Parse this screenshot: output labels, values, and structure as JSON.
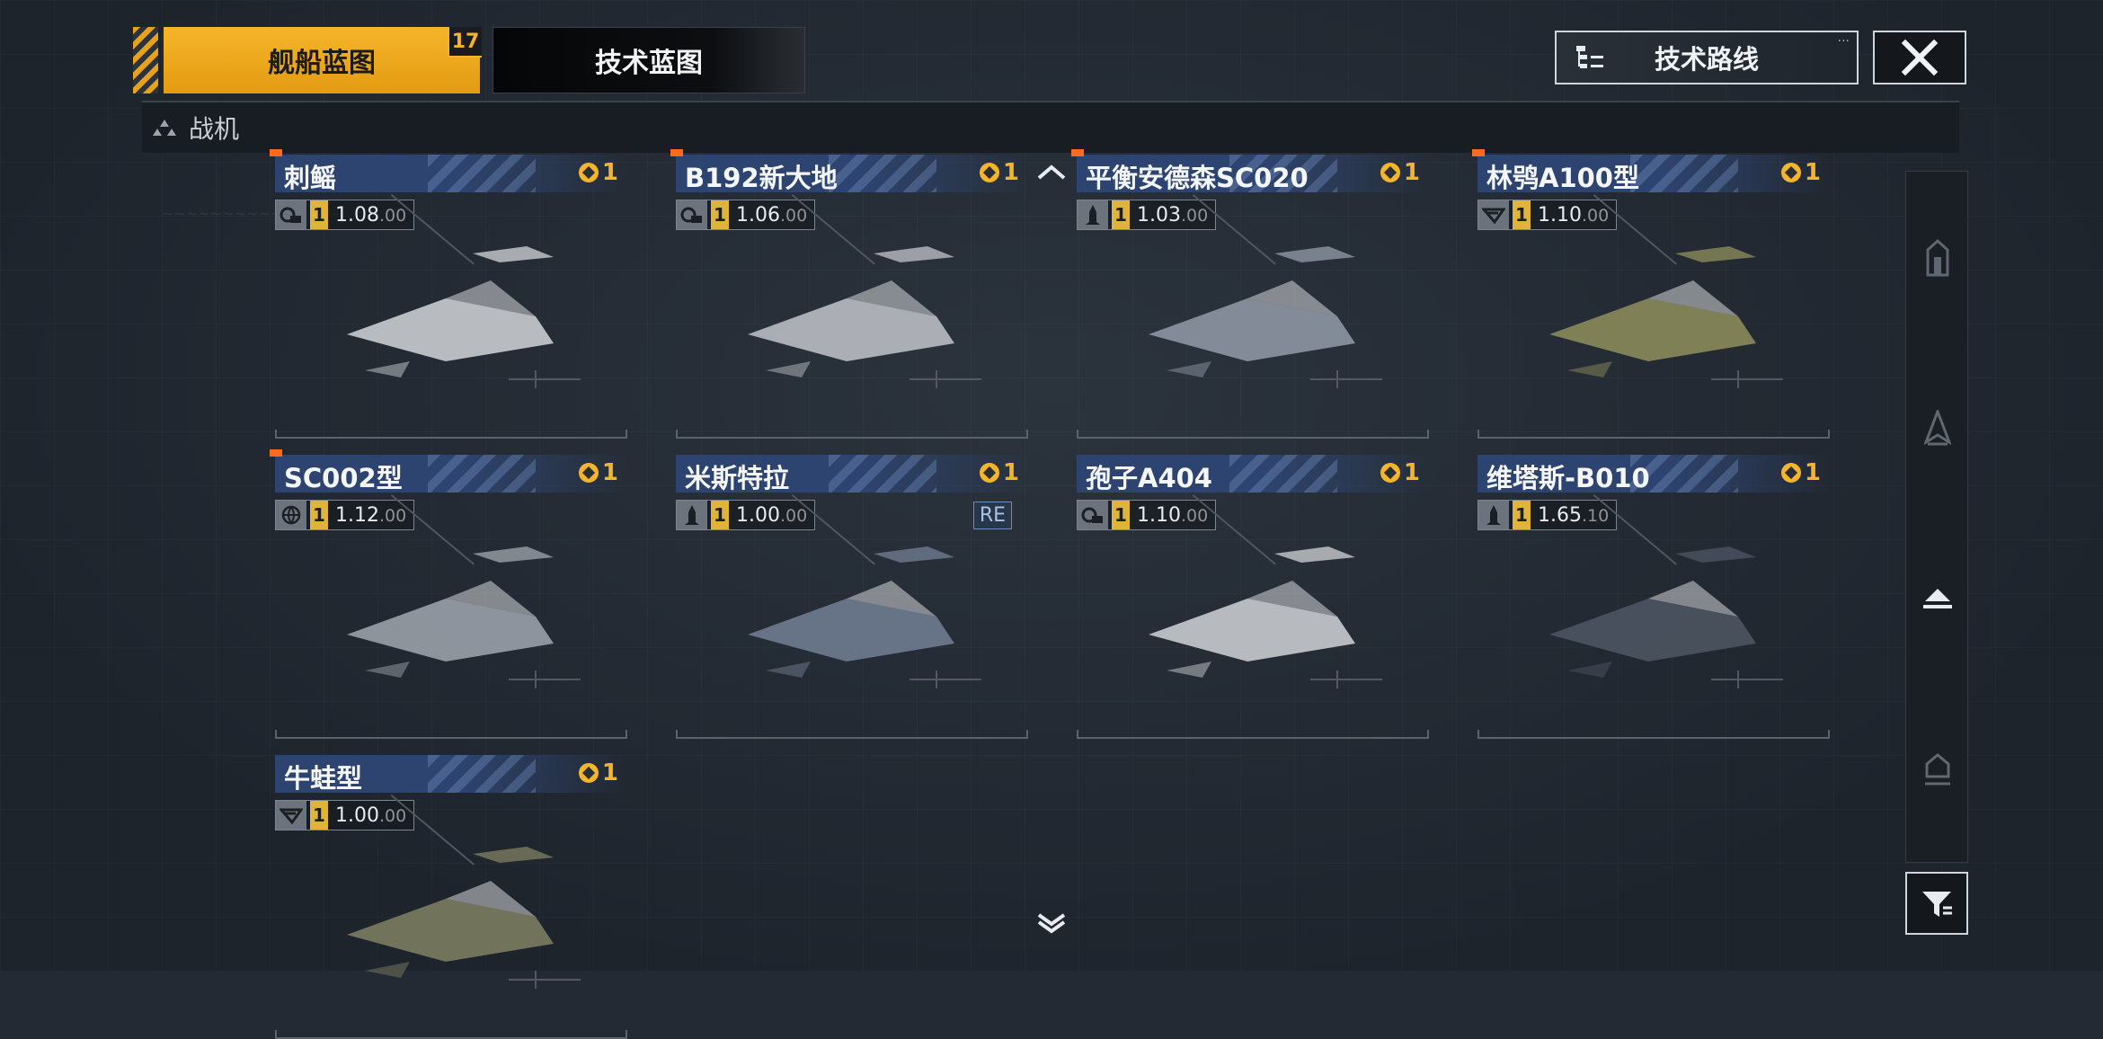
{
  "tabs": [
    {
      "label": "舰船蓝图",
      "active": true,
      "badge": "17"
    },
    {
      "label": "技术蓝图",
      "active": false
    }
  ],
  "header": {
    "route_button_label": "技术路线",
    "close_icon": "close-icon"
  },
  "section": {
    "title": "战机",
    "icon": "fighter-category-icon"
  },
  "cards": [
    {
      "name": "刺鳐",
      "cost": "1",
      "role_icon": "carrier-icon",
      "level": "1",
      "stat_main": "1.08",
      "stat_sub": ".00",
      "flag": true
    },
    {
      "name": "B192新大地",
      "cost": "1",
      "role_icon": "carrier-icon",
      "level": "1",
      "stat_main": "1.06",
      "stat_sub": ".00",
      "flag": true
    },
    {
      "name": "平衡安德森SC020",
      "cost": "1",
      "role_icon": "missile-icon",
      "level": "1",
      "stat_main": "1.03",
      "stat_sub": ".00",
      "flag": true
    },
    {
      "name": "林鸮A100型",
      "cost": "1",
      "role_icon": "wing-icon",
      "level": "1",
      "stat_main": "1.10",
      "stat_sub": ".00",
      "flag": true
    },
    {
      "name": "SC002型",
      "cost": "1",
      "role_icon": "globe-icon",
      "level": "1",
      "stat_main": "1.12",
      "stat_sub": ".00",
      "flag": true
    },
    {
      "name": "米斯特拉",
      "cost": "1",
      "role_icon": "missile-icon",
      "level": "1",
      "stat_main": "1.00",
      "stat_sub": ".00",
      "flag": false,
      "tag": "RE"
    },
    {
      "name": "孢子A404",
      "cost": "1",
      "role_icon": "carrier-icon",
      "level": "1",
      "stat_main": "1.10",
      "stat_sub": ".00",
      "flag": false
    },
    {
      "name": "维塔斯-B010",
      "cost": "1",
      "role_icon": "missile-icon",
      "level": "1",
      "stat_main": "1.65",
      "stat_sub": ".10",
      "flag": false
    },
    {
      "name": "牛蛙型",
      "cost": "1",
      "role_icon": "wing-icon",
      "level": "1",
      "stat_main": "1.00",
      "stat_sub": ".00",
      "flag": false
    }
  ],
  "side_filters": [
    "frigate-filter-icon",
    "cruiser-filter-icon",
    "fighter-filter-icon",
    "capital-filter-icon"
  ],
  "colors": {
    "accent": "#f5b52a",
    "card_header": "#2e4470",
    "flag": "#ff6a1f"
  }
}
